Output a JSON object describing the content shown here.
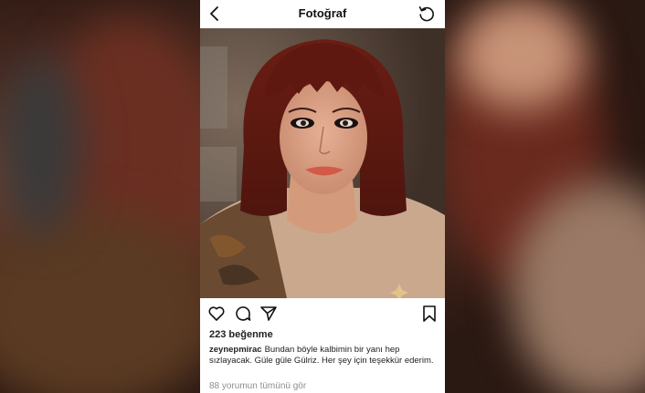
{
  "header": {
    "title": "Fotoğraf",
    "back_icon": "chevron-left-icon",
    "refresh_icon": "refresh-icon"
  },
  "post": {
    "likes": "223 beğenme",
    "username": "zeynepmirac",
    "caption": "Bundan böyle kalbimin bir yanı hep sızlayacak. Güle güle Gülriz. Her şey için teşekkür ederim.",
    "view_comments": "88 yorumun tümünü gör"
  },
  "actions": {
    "icons": [
      "heart-icon",
      "comment-icon",
      "share-icon",
      "bookmark-icon"
    ]
  },
  "colors": {
    "text": "#222222",
    "muted": "#8e8e8e",
    "hair": "#6e1f14"
  }
}
